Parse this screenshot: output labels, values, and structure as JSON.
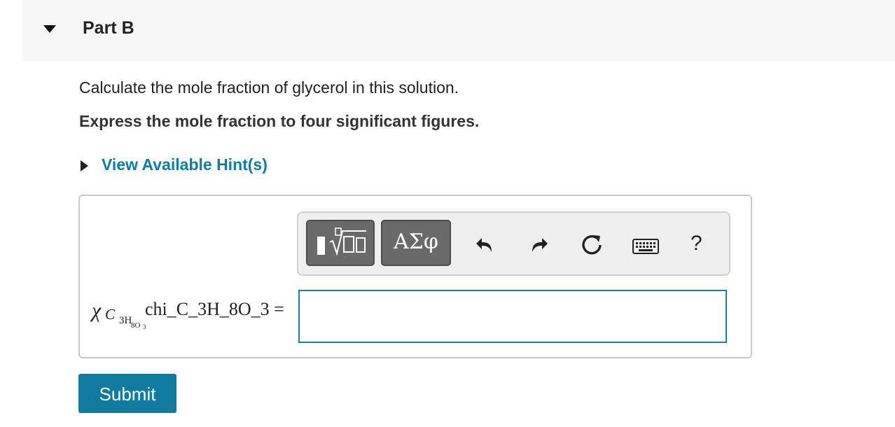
{
  "part": {
    "title": "Part B"
  },
  "question": {
    "prompt": "Calculate the mole fraction of glycerol in this solution.",
    "instruction": "Express the mole fraction to four significant figures."
  },
  "hint": {
    "label": "View Available Hint(s)"
  },
  "toolbar": {
    "greek_label": "ΑΣφ",
    "help_label": "?"
  },
  "answer": {
    "symbol": "χ",
    "subscript": "C",
    "subscript2": "3H",
    "subscript3": "8O",
    "subscript4": "3",
    "alt_text": "chi_C_3H_8O_3 =",
    "value": ""
  },
  "submit": {
    "label": "Submit"
  },
  "colors": {
    "link": "#0a7ea4",
    "submit": "#117a9f",
    "input_border": "#1a7fa0"
  }
}
